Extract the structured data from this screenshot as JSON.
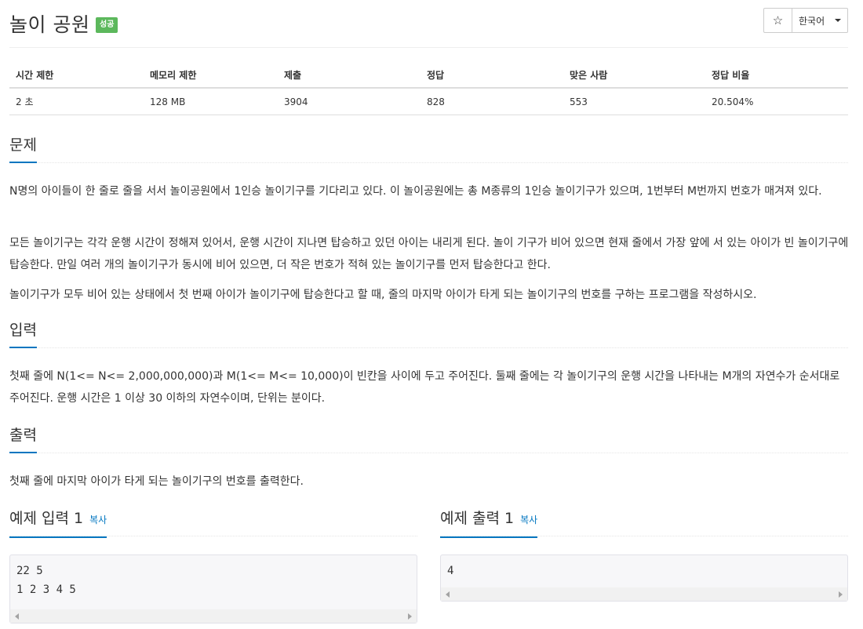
{
  "header": {
    "title": "놀이 공원",
    "badge": "성공",
    "star_glyph": "☆",
    "language": "한국어"
  },
  "info_table": {
    "headers": [
      "시간 제한",
      "메모리 제한",
      "제출",
      "정답",
      "맞은 사람",
      "정답 비율"
    ],
    "values": [
      "2 초",
      "128 MB",
      "3904",
      "828",
      "553",
      "20.504%"
    ]
  },
  "problem": {
    "heading": "문제",
    "paragraphs": [
      "N명의 아이들이 한 줄로 줄을 서서 놀이공원에서 1인승 놀이기구를 기다리고 있다. 이 놀이공원에는 총 M종류의 1인승 놀이기구가 있으며, 1번부터 M번까지 번호가 매겨져 있다.",
      "모든 놀이기구는 각각 운행 시간이 정해져 있어서, 운행 시간이 지나면 탑승하고 있던 아이는 내리게 된다. 놀이 기구가 비어 있으면 현재 줄에서 가장 앞에 서 있는 아이가 빈 놀이기구에 탑승한다. 만일 여러 개의 놀이기구가 동시에 비어 있으면, 더 작은 번호가 적혀 있는 놀이기구를 먼저 탑승한다고 한다.",
      "놀이기구가 모두 비어 있는 상태에서 첫 번째 아이가 놀이기구에 탑승한다고 할 때, 줄의 마지막 아이가 타게 되는 놀이기구의 번호를 구하는 프로그램을 작성하시오."
    ]
  },
  "input": {
    "heading": "입력",
    "text": "첫째 줄에 N(1<= N<= 2,000,000,000)과 M(1<= M<= 10,000)이 빈칸을 사이에 두고 주어진다. 둘째 줄에는 각 놀이기구의 운행 시간을 나타내는 M개의 자연수가 순서대로 주어진다. 운행 시간은 1 이상 30 이하의 자연수이며, 단위는 분이다."
  },
  "output": {
    "heading": "출력",
    "text": "첫째 줄에 마지막 아이가 타게 되는 놀이기구의 번호를 출력한다."
  },
  "sample_input": {
    "heading": "예제 입력 1",
    "copy_label": "복사",
    "content": "22 5\n1 2 3 4 5"
  },
  "sample_output": {
    "heading": "예제 출력 1",
    "copy_label": "복사",
    "content": "4"
  },
  "colors": {
    "accent": "#0076c0",
    "badge_success": "#5cb85c"
  }
}
